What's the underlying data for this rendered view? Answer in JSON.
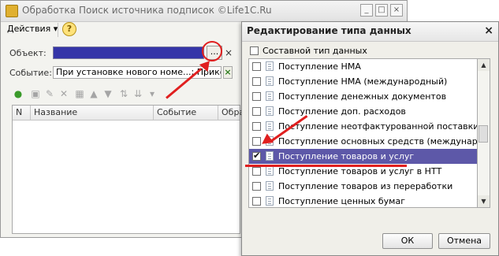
{
  "bg_window": {
    "title": "Обработка  Поиск источника подписок  ©Life1C.Ru",
    "minimize": "_",
    "maximize": "□",
    "close": "×",
    "menu_actions": "Действия ▾",
    "help_label": "?",
    "object_label": "Объект:",
    "object_select_label": "...",
    "object_clear_label": "×",
    "event_label": "Событие:",
    "event_value": "При установке нового номе...; Прико",
    "event_clear_label": "×",
    "grid_columns": [
      "N",
      "Название",
      "Событие",
      "Обра"
    ]
  },
  "dialog": {
    "title": "Редактирование типа данных",
    "close": "×",
    "composite_label": "Составной тип данных",
    "items": [
      {
        "label": "Поступление НМА",
        "checked": false
      },
      {
        "label": "Поступление НМА (международный)",
        "checked": false
      },
      {
        "label": "Поступление денежных документов",
        "checked": false
      },
      {
        "label": "Поступление доп. расходов",
        "checked": false
      },
      {
        "label": "Поступление неотфактурованной поставки",
        "checked": false
      },
      {
        "label": "Поступление основных средств (международн...",
        "checked": false
      },
      {
        "label": "Поступление товаров и услуг",
        "checked": true
      },
      {
        "label": "Поступление товаров и услуг в НТТ",
        "checked": false
      },
      {
        "label": "Поступление товаров из переработки",
        "checked": false
      },
      {
        "label": "Поступление ценных бумаг",
        "checked": false
      }
    ],
    "ok_label": "ОК",
    "cancel_label": "Отмена"
  },
  "colors": {
    "accent_red": "#e01f1f",
    "selection": "#5d58a8"
  }
}
